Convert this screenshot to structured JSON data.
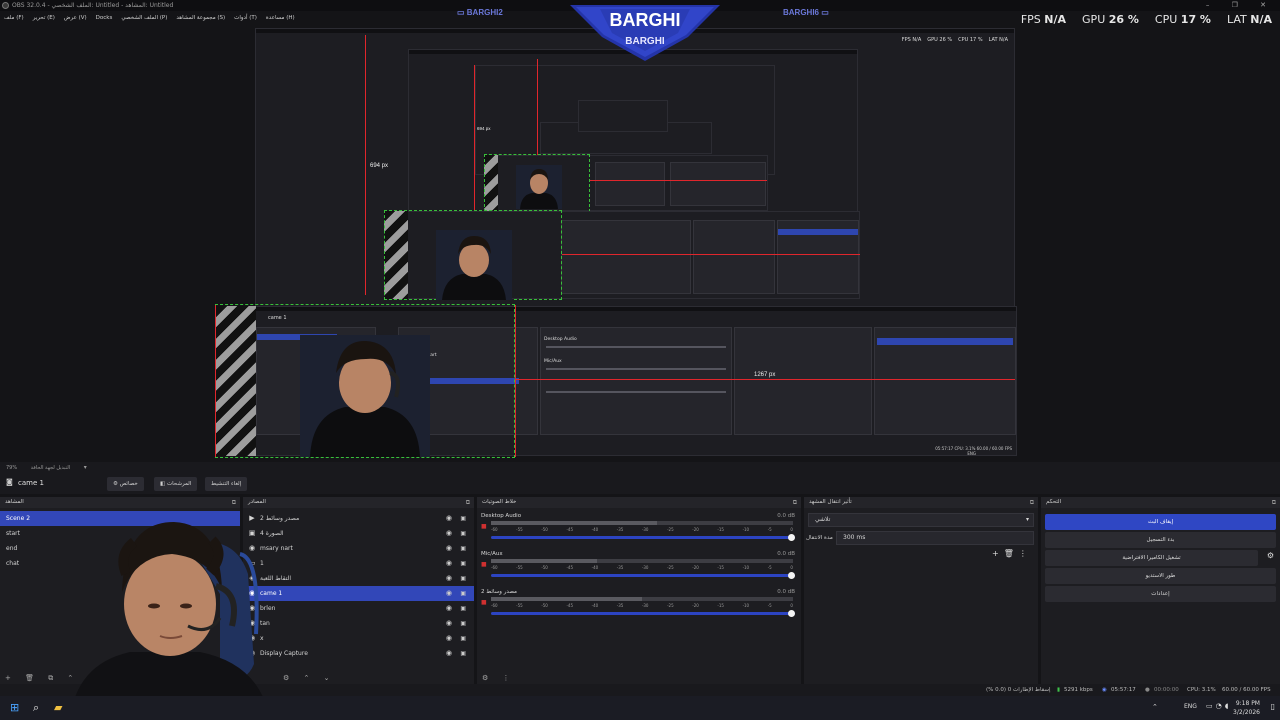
{
  "window": {
    "title": "OBS 32.0.4 - الملف الشخصي: Untitled - المشاهد: Untitled",
    "controls": "– ❐ ✕"
  },
  "menu": [
    "ملف (F)",
    "تحرير (E)",
    "عرض (V)",
    "Docks",
    "الملف الشخصي (P)",
    "مجموعة المشاهد (S)",
    "أدوات (T)",
    "مساعدة (H)"
  ],
  "overlay": {
    "brand": "BARGHI",
    "brand_sub": "BARGHI",
    "side_left": "BARGHI2",
    "side_right": "BARGHI6",
    "stats": [
      {
        "label": "FPS",
        "value": "N/A"
      },
      {
        "label": "GPU",
        "value": "26 %"
      },
      {
        "label": "CPU",
        "value": "17 %"
      },
      {
        "label": "LAT",
        "value": "N/A"
      }
    ],
    "mini_stats": [
      "FPS N/A",
      "GPU 26 %",
      "CPU 17 %",
      "LAT N/A"
    ]
  },
  "preview": {
    "measure_height": "694 px",
    "measure_width": "1267 px",
    "measure_height_inner": "694 px",
    "inner_scene": "came 1",
    "inner_status": "05:57:17  CPU: 3.1%  60.00 / 60.00 FPS",
    "inner_sources": [
      "msary nart"
    ],
    "inner_audio": [
      "Desktop Audio",
      "Mic/Aux"
    ],
    "inner_lang": "ENG"
  },
  "toolbar": {
    "zoom": "79%",
    "mode": "التبديل لجهة الحافة",
    "scene_name": "came 1",
    "buttons": [
      "خصائص",
      "المرشحات",
      "إلغاء التنشيط"
    ]
  },
  "docks": {
    "scenes": {
      "title": "المشاهد",
      "items": [
        "Scene 2",
        "start",
        "end",
        "chat"
      ],
      "selected": 0
    },
    "sources": {
      "title": "المصادر",
      "items": [
        {
          "icon": "▶",
          "name": "مصدر وسائط 2"
        },
        {
          "icon": "▣",
          "name": "الصورة 4"
        },
        {
          "icon": "◉",
          "name": "msary nart"
        },
        {
          "icon": "▭",
          "name": "1"
        },
        {
          "icon": "◈",
          "name": "التقاط اللعبة"
        },
        {
          "icon": "◉",
          "name": "came 1"
        },
        {
          "icon": "◉",
          "name": "brlen"
        },
        {
          "icon": "◉",
          "name": "tan"
        },
        {
          "icon": "◉",
          "name": "x"
        },
        {
          "icon": "◉",
          "name": "Display Capture"
        }
      ],
      "selected": 5
    },
    "mixer": {
      "title": "خلاط الصوتيات",
      "channels": [
        {
          "name": "Desktop Audio",
          "db": "0.0 dB",
          "level": 0.55
        },
        {
          "name": "Mic/Aux",
          "db": "0.0 dB",
          "level": 0.35
        },
        {
          "name": "مصدر وسائط 2",
          "db": "0.0 dB",
          "level": 0.5
        }
      ],
      "ticks": [
        "-60",
        "-55",
        "-50",
        "-45",
        "-40",
        "-35",
        "-30",
        "-25",
        "-20",
        "-15",
        "-10",
        "-5",
        "0"
      ]
    },
    "transitions": {
      "title": "تأثير انتقال المشهد",
      "type": "تلاشي",
      "duration_label": "مدة الانتقال",
      "duration_value": "300 ms"
    },
    "controls": {
      "title": "التحكم",
      "buttons": [
        "إيقاف البث",
        "بدء التسجيل",
        "تشغيل الكاميرا الافتراضية",
        "طور الاستديو",
        "إعدادات"
      ]
    }
  },
  "status": {
    "dropped": "إسقاط الإطارات 0 (0.0 %)",
    "bitrate": "5291 kbps",
    "stream_time": "05:57:17",
    "rec_time": "00:00:00",
    "cpu": "CPU: 3.1%",
    "fps": "60.00 / 60.00 FPS"
  },
  "taskbar": {
    "lang": "ENG",
    "time": "9:18 PM",
    "date": "3/2/2026"
  }
}
